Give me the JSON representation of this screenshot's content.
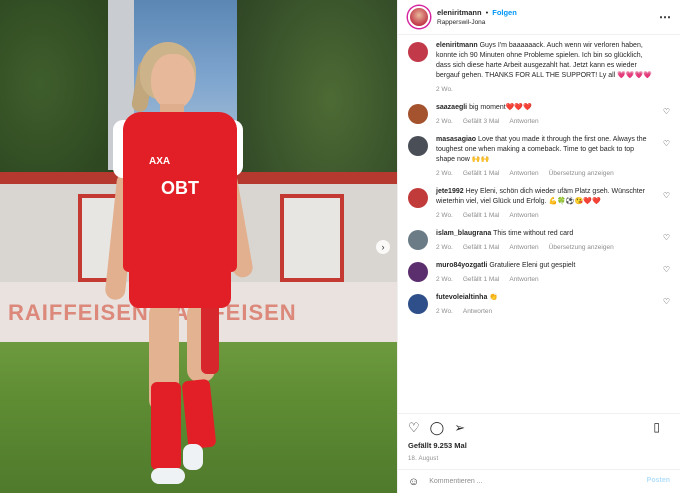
{
  "post": {
    "username": "eleniritmann",
    "separator": "•",
    "follow_label": "Folgen",
    "location": "Rapperswil-Jona",
    "more_icon": "⋯",
    "next_icon": "›"
  },
  "photo": {
    "shirt_brand": "OBT",
    "shirt_sponsor_small": "AXA",
    "banner_text": "RAIFFEISEN     RAIFFEISEN"
  },
  "comments": [
    {
      "username": "eleniritmann",
      "text": "Guys I'm baaaaaack. Auch wenn wir verloren haben, konnte ich 90 Minuten ohne Probleme spielen. Ich bin so glücklich, dass sich diese harte Arbeit ausgezahlt hat. Jetzt kann es wieder bergauf gehen. THANKS FOR ALL THE SUPPORT! Ly all 💗💗💗💗",
      "time": "2 Wo.",
      "likes": "",
      "reply": "",
      "translate": "",
      "avatar_color": "#c2394a",
      "has_heart": false
    },
    {
      "username": "saazaegli",
      "text": "big moment❤️❤️❤️",
      "time": "2 Wo.",
      "likes": "Gefällt 3 Mal",
      "reply": "Antworten",
      "translate": "",
      "avatar_color": "#a4532e",
      "has_heart": true
    },
    {
      "username": "masasagiao",
      "text": "Love that you made it through the first one. Always the toughest one when making a comeback. Time to get back to top shape now 🙌🙌",
      "time": "2 Wo.",
      "likes": "Gefällt 1 Mal",
      "reply": "Antworten",
      "translate": "Übersetzung anzeigen",
      "avatar_color": "#4a4f57",
      "has_heart": true
    },
    {
      "username": "jete1992",
      "text": "Hey Eleni, schön dich wieder ufäm Platz gseh. Wünschter wieterhin viel, viel Glück und Erfolg. 💪🍀⚽😘❤️❤️",
      "time": "2 Wo.",
      "likes": "Gefällt 1 Mal",
      "reply": "Antworten",
      "translate": "",
      "avatar_color": "#c23b3b",
      "has_heart": true
    },
    {
      "username": "islam_blaugrana",
      "text": "This time without red card",
      "time": "2 Wo.",
      "likes": "Gefällt 1 Mal",
      "reply": "Antworten",
      "translate": "Übersetzung anzeigen",
      "avatar_color": "#6b7c86",
      "has_heart": true
    },
    {
      "username": "muro84yozgatli",
      "text": "Gratuliere Eleni gut gespielt",
      "time": "2 Wo.",
      "likes": "Gefällt 1 Mal",
      "reply": "Antworten",
      "translate": "",
      "avatar_color": "#5b2e6e",
      "has_heart": true
    },
    {
      "username": "futevoleialtinha",
      "text": "👏",
      "time": "2 Wo.",
      "likes": "",
      "reply": "Antworten",
      "translate": "",
      "avatar_color": "#2f4f8a",
      "has_heart": true
    }
  ],
  "actions": {
    "like_icon": "♡",
    "comment_icon": "◯",
    "share_icon": "➢",
    "save_icon": "▯"
  },
  "likes_text": "Gefällt 9.253 Mal",
  "date_text": "18. August",
  "composer": {
    "emoji_icon": "☺",
    "placeholder": "Kommentieren ...",
    "post_label": "Posten"
  },
  "colors": {
    "accent": "#0095f6",
    "jersey": "#e21f26",
    "muted": "#8e8e8e"
  }
}
